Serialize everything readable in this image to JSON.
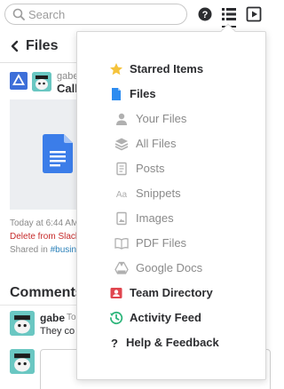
{
  "topbar": {
    "search_placeholder": "Search",
    "help_icon": "help-circle-icon",
    "menu_icon": "list-menu-icon",
    "play_icon": "play-square-icon"
  },
  "header": {
    "title": "Files"
  },
  "file": {
    "author": "gabe",
    "name": "Call",
    "date": "Today at 6:44 AM",
    "delete_label": "Delete from Slack",
    "shared_label": "Shared in",
    "shared_channel": "#busin"
  },
  "comments": {
    "heading": "Comments",
    "items": [
      {
        "user": "gabe",
        "time": "To",
        "text": "They co"
      }
    ]
  },
  "menu": {
    "items": [
      {
        "label": "Starred Items",
        "icon": "star-icon"
      },
      {
        "label": "Files",
        "icon": "file-icon"
      },
      {
        "label": "Your Files",
        "icon": "user-icon"
      },
      {
        "label": "All Files",
        "icon": "stack-icon"
      },
      {
        "label": "Posts",
        "icon": "post-icon"
      },
      {
        "label": "Snippets",
        "icon": "snippet-icon"
      },
      {
        "label": "Images",
        "icon": "image-icon"
      },
      {
        "label": "PDF Files",
        "icon": "book-icon"
      },
      {
        "label": "Google Docs",
        "icon": "google-drive-icon"
      },
      {
        "label": "Team Directory",
        "icon": "team-directory-icon"
      },
      {
        "label": "Activity Feed",
        "icon": "activity-clock-icon"
      },
      {
        "label": "Help & Feedback",
        "icon": "question-icon"
      }
    ]
  },
  "colors": {
    "star": "#f5c33b",
    "files_blue": "#2d8cf0",
    "directory_red": "#e0464f",
    "activity_green": "#2fb67c",
    "delete_red": "#c62b2b",
    "link_blue": "#2a80b9",
    "avatar_teal": "#6ac7c2"
  }
}
